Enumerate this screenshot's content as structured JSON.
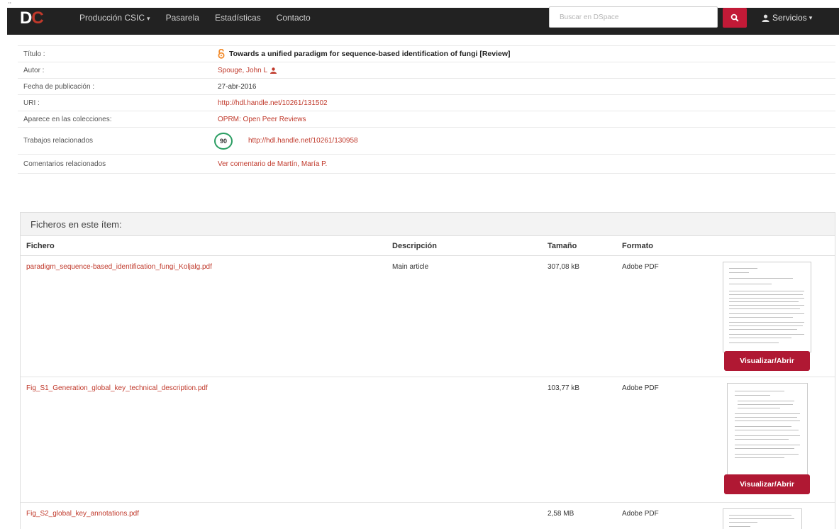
{
  "nav": {
    "logo_d": "D",
    "logo_c": "C",
    "logo_dots": "¨",
    "items": [
      {
        "label": "Producción CSIC",
        "dropdown": true
      },
      {
        "label": "Pasarela",
        "dropdown": false
      },
      {
        "label": "Estadísticas",
        "dropdown": false
      },
      {
        "label": "Contacto",
        "dropdown": false
      }
    ],
    "search_placeholder": "Buscar en DSpace",
    "services_label": "Servicios",
    "accent_color": "#c21a37"
  },
  "metadata": {
    "title_label": "Título :",
    "title_value": "Towards a unified paradigm for sequence-based identification of fungi [Review]",
    "author_label": "Autor :",
    "author_value": "Spouge, John L",
    "date_label": "Fecha de publicación :",
    "date_value": "27-abr-2016",
    "uri_label": "URI :",
    "uri_value": "http://hdl.handle.net/10261/131502",
    "collections_label": "Aparece en las colecciones:",
    "collections_value": "OPRM: Open Peer Reviews",
    "related_label": "Trabajos relacionados",
    "related_badge": "90",
    "related_value": "http://hdl.handle.net/10261/130958",
    "comments_label": "Comentarios relacionados",
    "comments_value": "Ver comentario de Martín, María P."
  },
  "files": {
    "panel_title": "Ficheros en este ítem:",
    "columns": {
      "file": "Fichero",
      "description": "Descripción",
      "size": "Tamaño",
      "format": "Formato"
    },
    "rows": [
      {
        "name": "paradigm_sequence-based_identification_fungi_Koljalg.pdf",
        "description": "Main article",
        "size": "307,08 kB",
        "format": "Adobe PDF",
        "button": "Visualizar/Abrir"
      },
      {
        "name": "Fig_S1_Generation_global_key_technical_description.pdf",
        "description": "",
        "size": "103,77 kB",
        "format": "Adobe PDF",
        "button": "Visualizar/Abrir"
      },
      {
        "name": "Fig_S2_global_key_annotations.pdf",
        "description": "",
        "size": "2,58 MB",
        "format": "Adobe PDF"
      }
    ]
  }
}
